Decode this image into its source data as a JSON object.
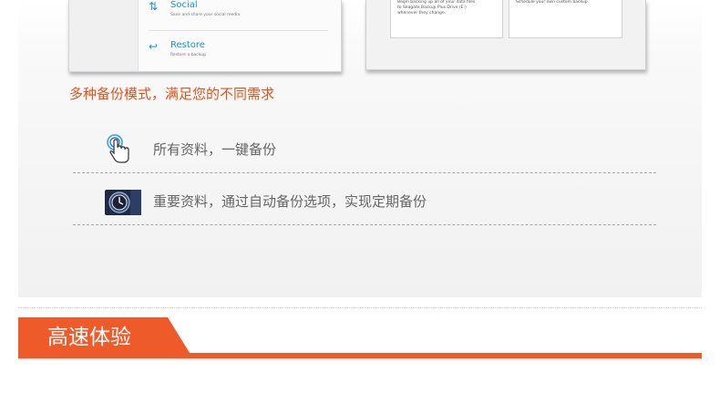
{
  "left_screenshot": {
    "items": [
      {
        "icon": "transfer-arrows-icon",
        "title": "Social",
        "subtitle": "Save and share your social media"
      },
      {
        "icon": "restore-arrow-icon",
        "title": "Restore",
        "subtitle": "Restore a backup"
      }
    ]
  },
  "right_screenshot": {
    "cards": [
      {
        "text": "Begin backing up all of your data files\nto Seagate Backup Plus Drive (E:)\nwhenever they change."
      },
      {
        "text": "Schedule your own custom backup."
      }
    ]
  },
  "tagline": "多种备份模式，满足您的不同需求",
  "features": [
    {
      "icon": "hand-pointer-icon",
      "label": "所有资料，一键备份"
    },
    {
      "icon": "time-machine-icon",
      "label": "重要资料，通过自动备份选项，实现定期备份"
    }
  ],
  "section_header": {
    "title": "高速体验"
  },
  "colors": {
    "accent": "#ef5a2b",
    "tagline": "#e0531c",
    "link_blue": "#1a8fd4"
  }
}
